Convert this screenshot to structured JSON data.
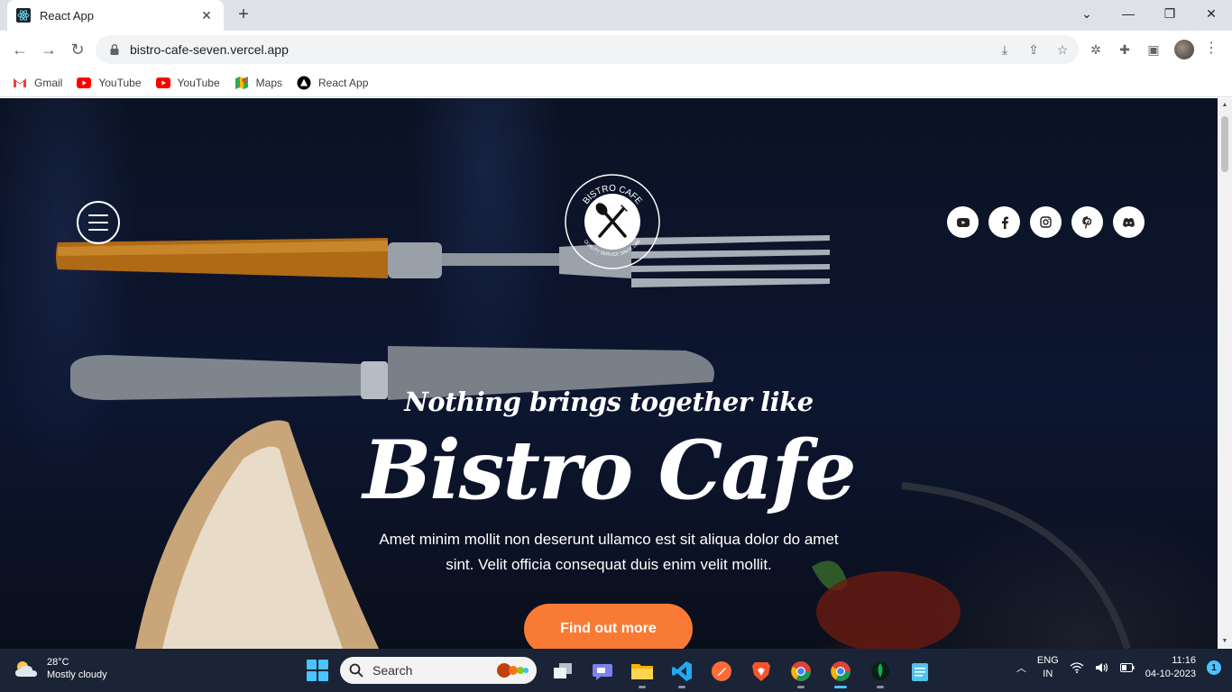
{
  "browser": {
    "tab_title": "React App",
    "url": "bistro-cafe-seven.vercel.app",
    "bookmarks": [
      {
        "label": "Gmail",
        "icon": "gmail-icon"
      },
      {
        "label": "YouTube",
        "icon": "youtube-icon"
      },
      {
        "label": "YouTube",
        "icon": "youtube-icon"
      },
      {
        "label": "Maps",
        "icon": "maps-icon"
      },
      {
        "label": "React App",
        "icon": "react-icon"
      }
    ]
  },
  "hero": {
    "logo_top_text": "BISTRO CAFE",
    "logo_bottom_text": "QUALITY SERVICE SINCE 1990",
    "tagline": "Nothing brings together like",
    "title": "Bistro Cafe",
    "description": "Amet minim mollit non deserunt ullamco est sit aliqua dolor do amet sint. Velit officia consequat duis enim velit mollit.",
    "cta_label": "Find out more",
    "accent_color": "#f97a34",
    "socials": [
      "youtube-icon",
      "facebook-icon",
      "instagram-icon",
      "pinterest-icon",
      "discord-icon"
    ]
  },
  "taskbar": {
    "temperature": "28°C",
    "weather": "Mostly cloudy",
    "search_label": "Search",
    "lang_top": "ENG",
    "lang_bottom": "IN",
    "time": "11:16",
    "date": "04-10-2023",
    "notifications": "1"
  }
}
